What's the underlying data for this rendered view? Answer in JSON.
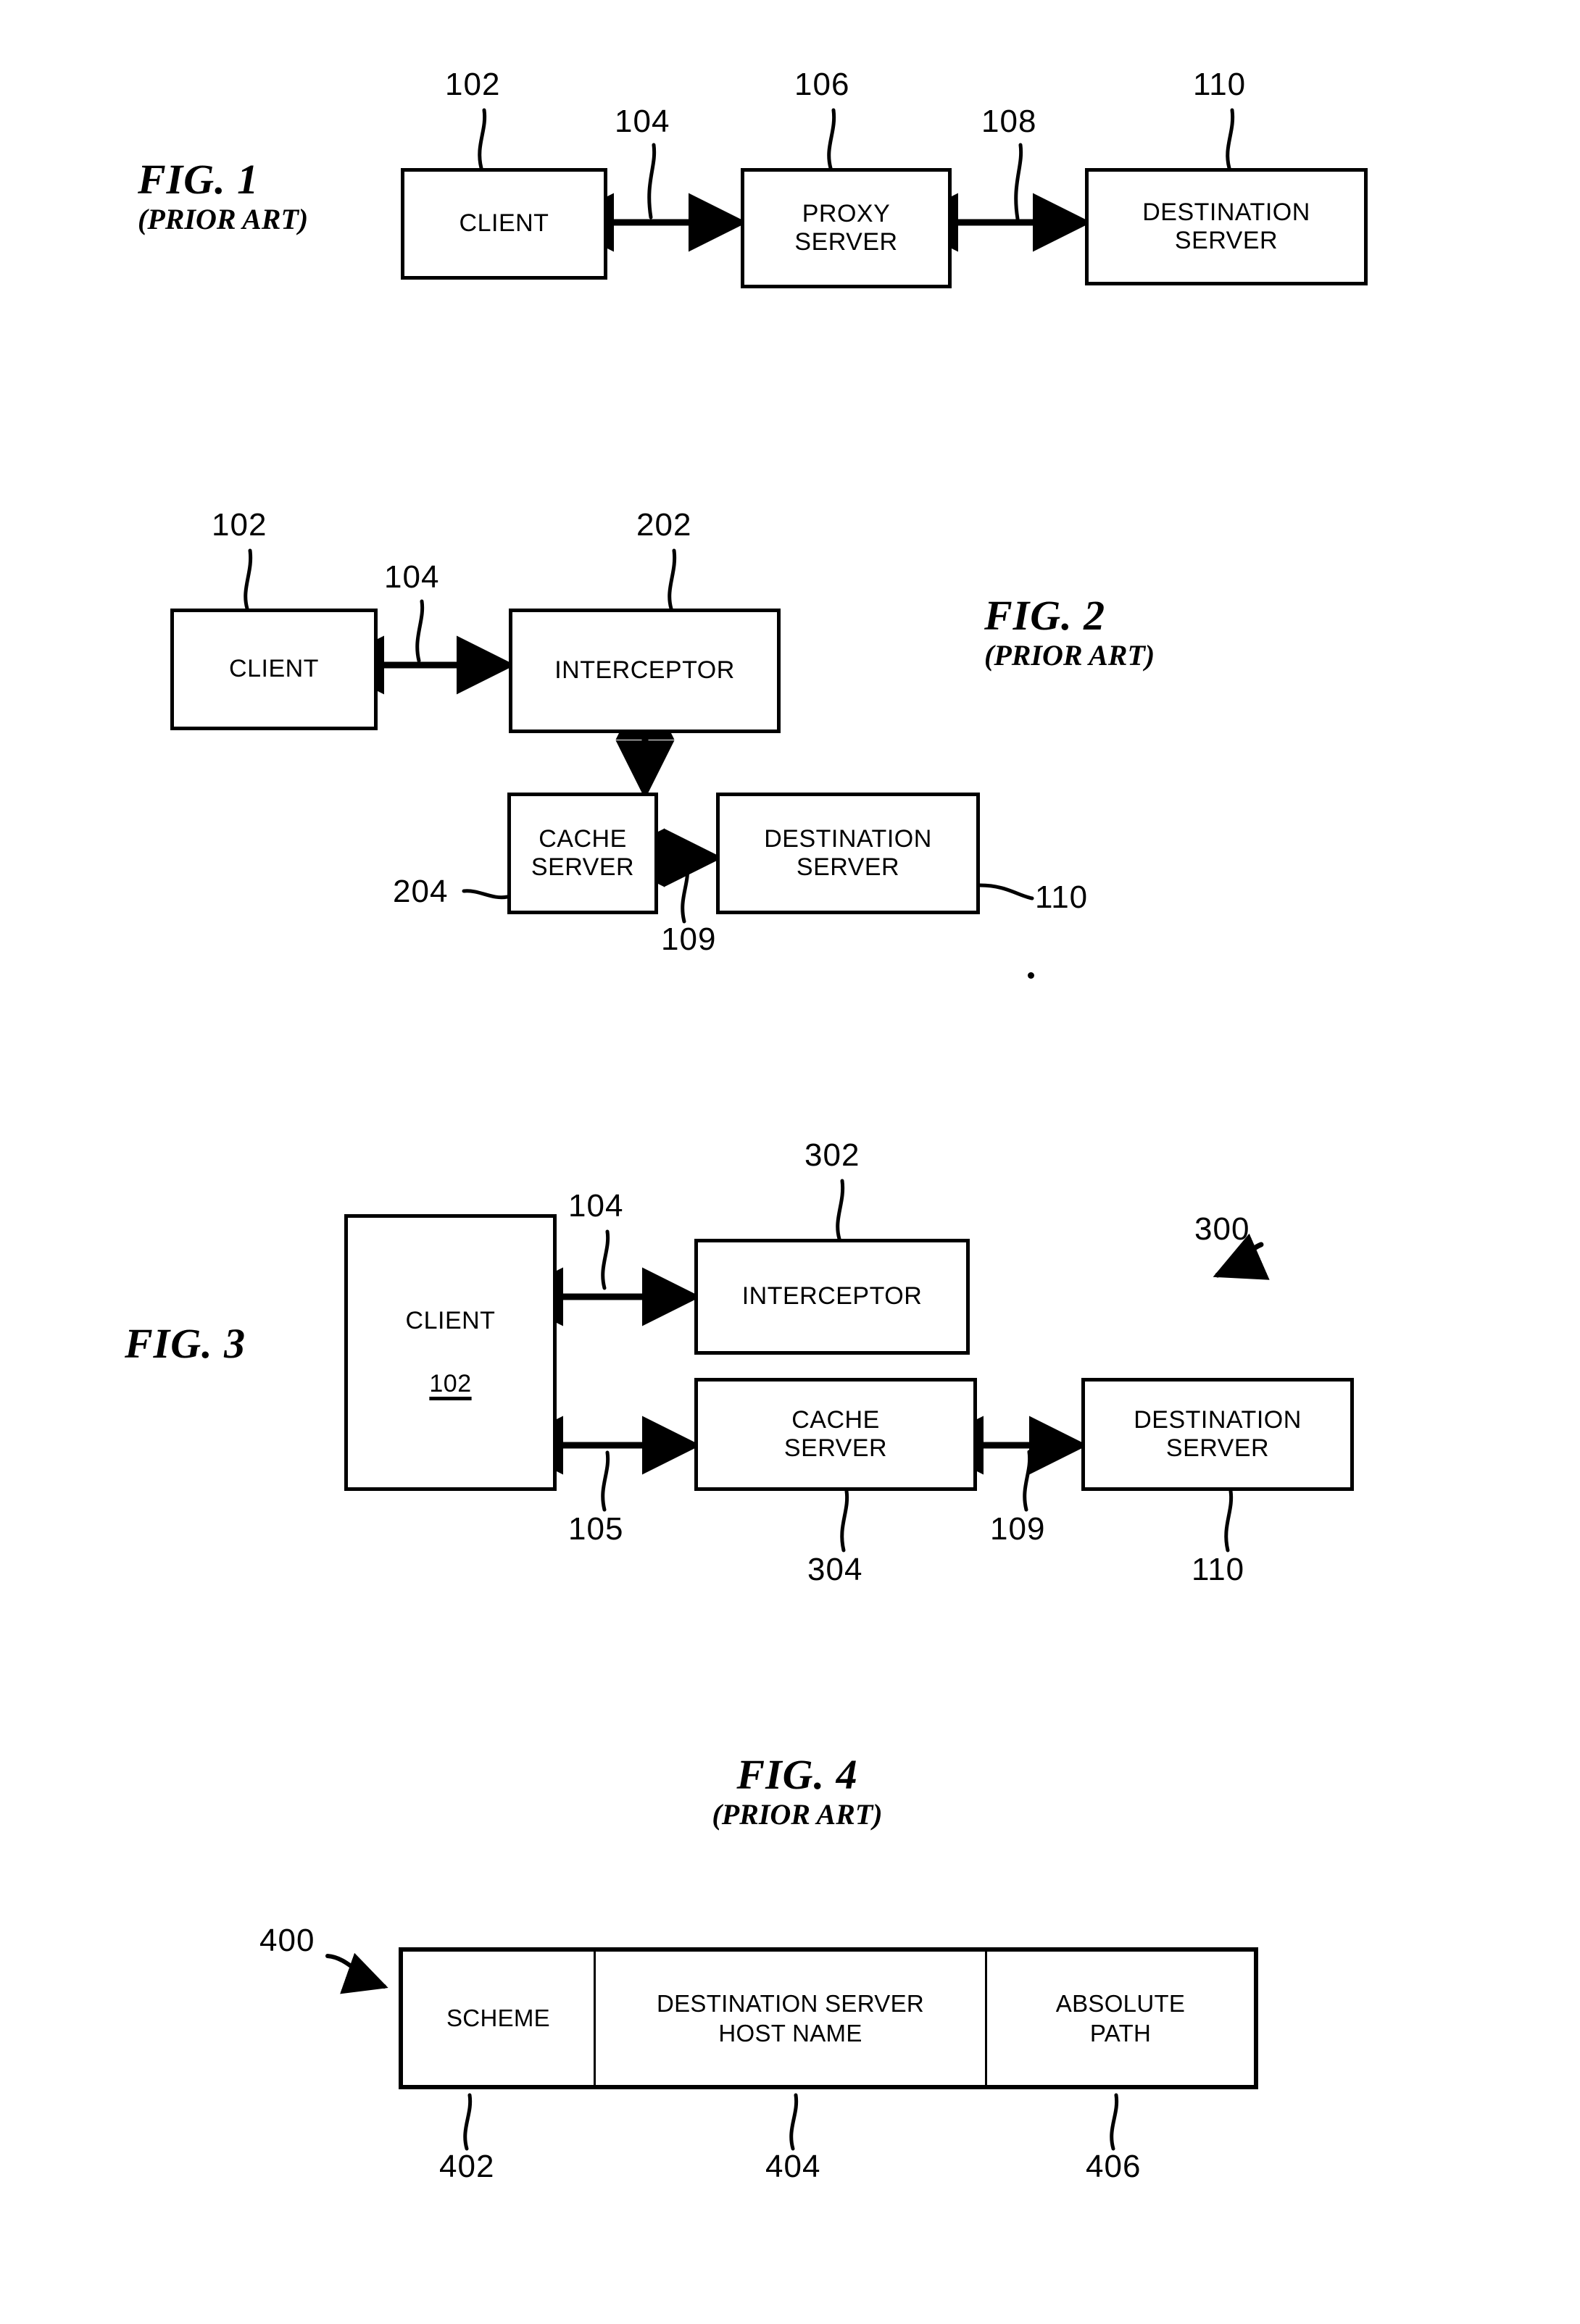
{
  "document": {
    "type": "patent-drawing-sheet",
    "figure_count": 4
  },
  "figures": [
    {
      "id": "fig1",
      "title": "FIG. 1",
      "subtitle": "(PRIOR ART)",
      "boxes": [
        {
          "id": "fig1-client",
          "label": "CLIENT",
          "ref": "102"
        },
        {
          "id": "fig1-proxy",
          "label_line1": "PROXY",
          "label_line2": "SERVER",
          "ref": "106"
        },
        {
          "id": "fig1-destination",
          "label_line1": "DESTINATION",
          "label_line2": "SERVER",
          "ref": "110"
        }
      ],
      "connectors": [
        {
          "id": "fig1-link-104",
          "ref": "104",
          "from": "CLIENT",
          "to": "PROXY SERVER",
          "style": "double-arrow"
        },
        {
          "id": "fig1-link-108",
          "ref": "108",
          "from": "PROXY SERVER",
          "to": "DESTINATION SERVER",
          "style": "double-arrow"
        }
      ]
    },
    {
      "id": "fig2",
      "title": "FIG. 2",
      "subtitle": "(PRIOR ART)",
      "boxes": [
        {
          "id": "fig2-client",
          "label": "CLIENT",
          "ref": "102"
        },
        {
          "id": "fig2-interceptor",
          "label": "INTERCEPTOR",
          "ref": "202"
        },
        {
          "id": "fig2-cache",
          "label_line1": "CACHE",
          "label_line2": "SERVER",
          "ref": "204"
        },
        {
          "id": "fig2-destination",
          "label_line1": "DESTINATION",
          "label_line2": "SERVER",
          "ref": "110"
        }
      ],
      "connectors": [
        {
          "id": "fig2-link-104",
          "ref": "104",
          "from": "CLIENT",
          "to": "INTERCEPTOR",
          "style": "double-arrow"
        },
        {
          "id": "fig2-link-vertical",
          "ref": "",
          "from": "INTERCEPTOR",
          "to": "CACHE SERVER",
          "style": "double-arrow-vertical"
        },
        {
          "id": "fig2-link-109",
          "ref": "109",
          "from": "CACHE SERVER",
          "to": "DESTINATION SERVER",
          "style": "double-arrow"
        }
      ]
    },
    {
      "id": "fig3",
      "title": "FIG. 3",
      "subtitle": "",
      "system_ref": "300",
      "boxes": [
        {
          "id": "fig3-client",
          "label": "CLIENT",
          "ref": "102",
          "ref_inside": true
        },
        {
          "id": "fig3-interceptor",
          "label": "INTERCEPTOR",
          "ref": "302"
        },
        {
          "id": "fig3-cache",
          "label_line1": "CACHE",
          "label_line2": "SERVER",
          "ref": "304"
        },
        {
          "id": "fig3-destination",
          "label_line1": "DESTINATION",
          "label_line2": "SERVER",
          "ref": "110"
        }
      ],
      "connectors": [
        {
          "id": "fig3-link-104",
          "ref": "104",
          "from": "CLIENT",
          "to": "INTERCEPTOR",
          "style": "double-arrow"
        },
        {
          "id": "fig3-link-105",
          "ref": "105",
          "from": "CLIENT",
          "to": "CACHE SERVER",
          "style": "double-arrow"
        },
        {
          "id": "fig3-link-109",
          "ref": "109",
          "from": "CACHE SERVER",
          "to": "DESTINATION SERVER",
          "style": "double-arrow"
        }
      ]
    },
    {
      "id": "fig4",
      "title": "FIG. 4",
      "subtitle": "(PRIOR ART)",
      "structure_ref": "400",
      "cells": [
        {
          "id": "fig4-scheme",
          "label": "SCHEME",
          "ref": "402"
        },
        {
          "id": "fig4-host",
          "label_line1": "DESTINATION SERVER",
          "label_line2": "HOST NAME",
          "ref": "404"
        },
        {
          "id": "fig4-path",
          "label_line1": "ABSOLUTE",
          "label_line2": "PATH",
          "ref": "406"
        }
      ]
    }
  ],
  "colors": {
    "ink": "#000000",
    "paper": "#ffffff"
  }
}
